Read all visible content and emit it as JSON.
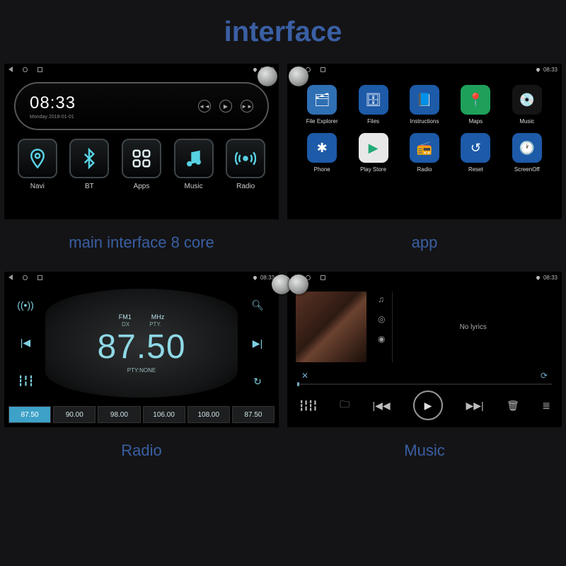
{
  "title": "interface",
  "status": {
    "time": "08:33"
  },
  "panels": {
    "main": {
      "caption": "main interface 8 core",
      "clock": "08:33",
      "date": "Monday   2018-01-01",
      "buttons": [
        {
          "label": "Navi",
          "icon": "pin"
        },
        {
          "label": "BT",
          "icon": "bt"
        },
        {
          "label": "Apps",
          "icon": "grid"
        },
        {
          "label": "Music",
          "icon": "note"
        },
        {
          "label": "Radio",
          "icon": "radio"
        }
      ]
    },
    "apps": {
      "caption": "app",
      "items": [
        {
          "label": "File Explorer",
          "bg": "#2f6fb3",
          "glyph": "🗂"
        },
        {
          "label": "Files",
          "bg": "#1d5aa8",
          "glyph": "🗄"
        },
        {
          "label": "Instructions",
          "bg": "#1d5aa8",
          "glyph": "📘"
        },
        {
          "label": "Maps",
          "bg": "#1ea05a",
          "glyph": "📍"
        },
        {
          "label": "Music",
          "bg": "#141414",
          "glyph": "💿"
        },
        {
          "label": "Phone",
          "bg": "#1d5aa8",
          "glyph": "✱"
        },
        {
          "label": "Play Store",
          "bg": "#e8e8e8",
          "glyph": "▶"
        },
        {
          "label": "Radio",
          "bg": "#1d5aa8",
          "glyph": "📻"
        },
        {
          "label": "Reset",
          "bg": "#1d5aa8",
          "glyph": "↺"
        },
        {
          "label": "ScreenOff",
          "bg": "#1d5aa8",
          "glyph": "🕐"
        }
      ]
    },
    "radio": {
      "caption": "Radio",
      "band": "FM1",
      "unit": "MHz",
      "dx": "DX",
      "pty_lbl": "PTY.",
      "freq": "87.50",
      "pty": "PTY:NONE",
      "presets": [
        "87.50",
        "90.00",
        "98.00",
        "106.00",
        "108.00",
        "87.50"
      ]
    },
    "music": {
      "caption": "Music",
      "lyrics": "No lyrics"
    }
  }
}
